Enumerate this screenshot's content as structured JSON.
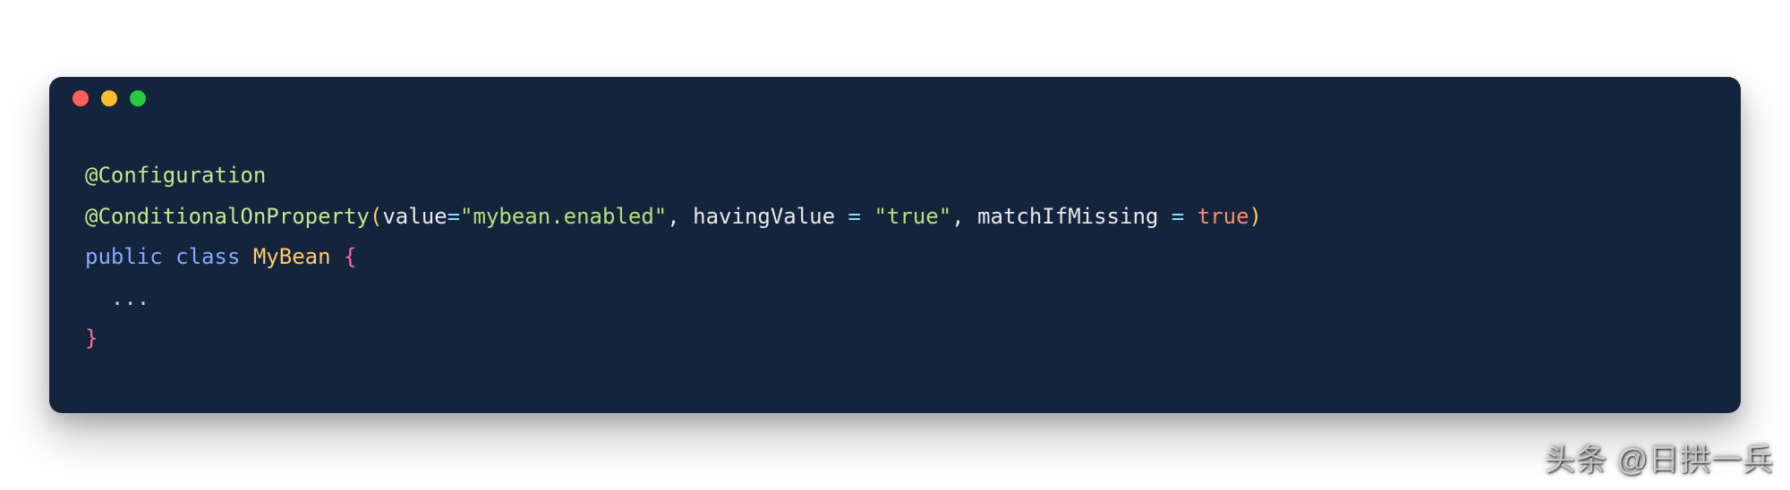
{
  "code": {
    "line1": {
      "annotation": "@Configuration"
    },
    "line2": {
      "annotation": "@ConditionalOnProperty",
      "lparen": "(",
      "param1": "value",
      "eq1": "=",
      "str1": "\"mybean.enabled\"",
      "comma1": ", ",
      "param2": "havingValue",
      "eq2": " = ",
      "str2": "\"true\"",
      "comma2": ", ",
      "param3": "matchIfMissing",
      "eq3": " = ",
      "bool": "true",
      "rparen": ")"
    },
    "line3": {
      "kw1": "public",
      "kw2": "class",
      "classname": "MyBean",
      "brace": "{"
    },
    "line4": {
      "dots": "..."
    },
    "line5": {
      "brace": "}"
    }
  },
  "watermark": "头条 @日拱一兵"
}
